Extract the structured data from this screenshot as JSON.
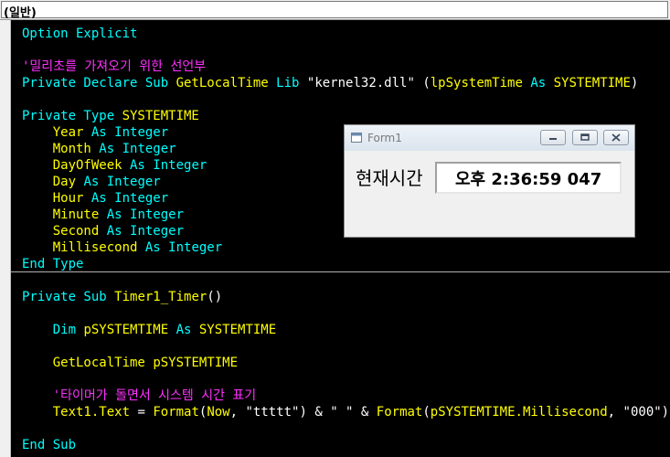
{
  "procedure_combo": {
    "value": "(일반)"
  },
  "code": {
    "l1": {
      "kw": "Option Explicit"
    },
    "l3": {
      "cm": "'밀리초를 가져오기 위한 선언부"
    },
    "l4": {
      "kw1": "Private Declare Sub ",
      "id1": "GetLocalTime",
      "kw2": " Lib ",
      "tx1": "\"kernel32.dll\" (",
      "id2": "lpSystemTime",
      "kw3": " As ",
      "id3": "SYSTEMTIME",
      "tx2": ")"
    },
    "l6": {
      "kw1": "Private Type ",
      "id1": "SYSTEMTIME"
    },
    "fields": [
      {
        "name": "Year",
        "as": " As ",
        "type": "Integer"
      },
      {
        "name": "Month",
        "as": " As ",
        "type": "Integer"
      },
      {
        "name": "DayOfWeek",
        "as": " As ",
        "type": "Integer"
      },
      {
        "name": "Day",
        "as": " As ",
        "type": "Integer"
      },
      {
        "name": "Hour",
        "as": " As ",
        "type": "Integer"
      },
      {
        "name": "Minute",
        "as": " As ",
        "type": "Integer"
      },
      {
        "name": "Second",
        "as": " As ",
        "type": "Integer"
      },
      {
        "name": "Millisecond",
        "as": " As ",
        "type": "Integer"
      }
    ],
    "l15": {
      "kw": "End Type"
    },
    "l17": {
      "kw1": "Private Sub ",
      "id1": "Timer1_Timer",
      "tx1": "()"
    },
    "l19": {
      "kw1": "Dim ",
      "id1": "pSYSTEMTIME",
      "kw2": " As ",
      "id2": "SYSTEMTIME"
    },
    "l21": {
      "id1": "GetLocalTime",
      "tx1": " ",
      "id2": "pSYSTEMTIME"
    },
    "l23": {
      "cm": "'타이머가 돌면서 시스템 시간 표기"
    },
    "l24": {
      "id1": "Text1.Text",
      "tx1": " = ",
      "id2": "Format",
      "tx2": "(",
      "id3": "Now",
      "tx3": ", \"ttttt\") & \" \" & ",
      "id4": "Format",
      "tx4": "(",
      "id5": "pSYSTEMTIME.Millisecond",
      "tx5": ", \"000\")"
    },
    "l26": {
      "kw": "End Sub"
    }
  },
  "form1": {
    "title": "Form1",
    "label": "현재시간",
    "textbox_value": "오후 2:36:59 047",
    "icons": [
      "form-icon",
      "minimize-icon",
      "maximize-icon",
      "close-icon"
    ]
  },
  "colors": {
    "keyword": "#00ffff",
    "identifier": "#ffff00",
    "comment": "#ff30ff",
    "background": "#000000"
  }
}
